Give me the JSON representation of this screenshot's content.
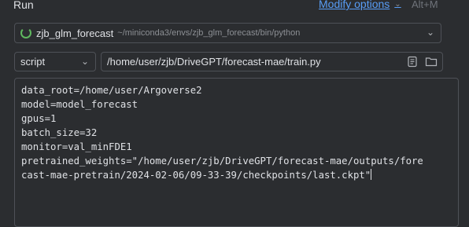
{
  "header": {
    "title": "Run",
    "modify_options": "Modify options",
    "shortcut": "Alt+M"
  },
  "interpreter": {
    "name": "zjb_glm_forecast",
    "path": "~/miniconda3/envs/zjb_glm_forecast/bin/python"
  },
  "run_target": {
    "type": "script",
    "path": "/home/user/zjb/DriveGPT/forecast-mae/train.py"
  },
  "parameters": {
    "lines": [
      "data_root=/home/user/Argoverse2",
      "model=model_forecast",
      "gpus=1",
      "batch_size=32",
      "monitor=val_minFDE1",
      "pretrained_weights=\"/home/user/zjb/DriveGPT/forecast-mae/outputs/fore",
      "cast-mae-pretrain/2024-02-06/09-33-39/checkpoints/last.ckpt\""
    ]
  },
  "icons": {
    "interpreter_status": "loading-spinner-icon",
    "dropdown": "chevron-down-icon",
    "browse_file": "file-icon",
    "browse_folder": "folder-icon"
  },
  "colors": {
    "background": "#2b2d30",
    "accent_link": "#589df6",
    "border": "#4e5157",
    "muted_text": "#8c8f94",
    "spinner": "#5fb85f"
  }
}
